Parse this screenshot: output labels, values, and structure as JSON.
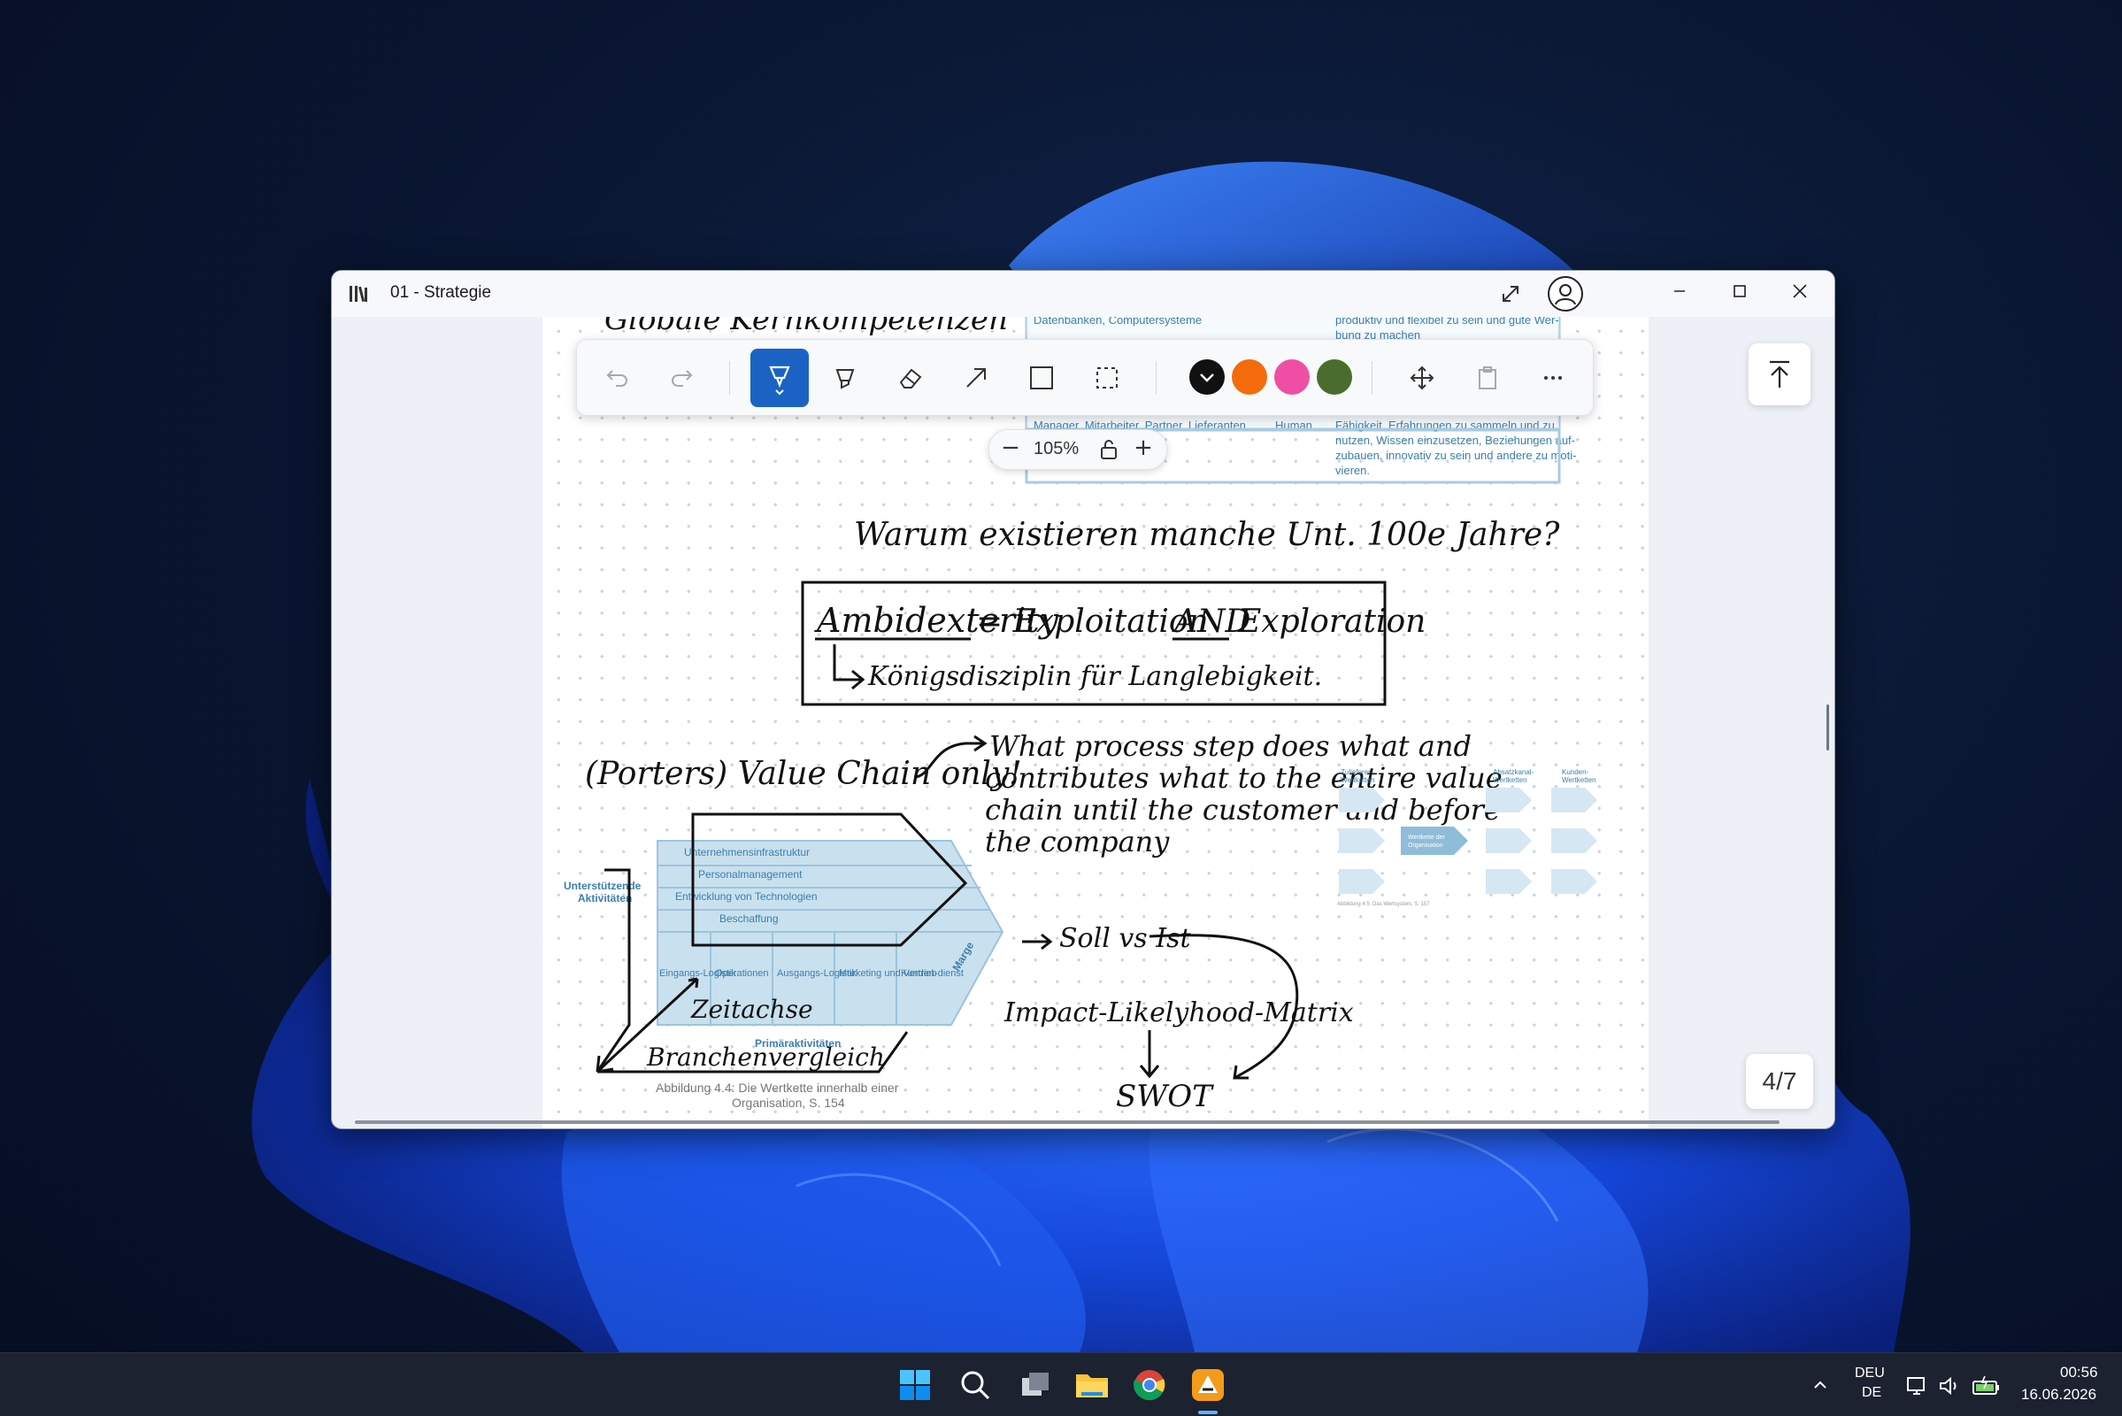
{
  "window": {
    "title": "01 - Strategie"
  },
  "toolbar": {
    "tools": [
      "undo-icon",
      "redo-icon",
      "pen-icon",
      "highlighter-icon",
      "eraser-icon",
      "arrow-icon",
      "rectangle-icon",
      "lasso-select-icon",
      "move-icon",
      "paste-icon",
      "more-icon"
    ],
    "active_tool": "pen-icon",
    "colors": [
      "#111111",
      "#f36b0b",
      "#ee4fa4",
      "#4a6d2e"
    ]
  },
  "zoom": {
    "minus": "−",
    "value": "105%",
    "plus": "+"
  },
  "page_counter": "4/7",
  "doc": {
    "top_table": {
      "row1_left": "Datenbanken, Computersysteme",
      "row1_right": "produktiv und flexibel zu sein und gute Wer-",
      "row1_right2": "bung zu machen",
      "row2_left": "Manager, Mitarbeiter, Partner, Lieferanten,",
      "row2_mid": "Human",
      "row2_right": [
        "Fähigkeit, Erfahrungen zu sammeln und zu",
        "nutzen, Wissen einzusetzen, Beziehungen auf-",
        "zubauen, innovativ zu sein und andere zu moti-",
        "vieren."
      ]
    },
    "handwriting": {
      "top_cut": "Globale Kernkompetenzen",
      "question": "Warum existieren manche Unt. 100e Jahre?",
      "box_line1_a": "Ambidexterity",
      "box_line1_b": "= Exploitation",
      "box_line1_c": "AND",
      "box_line1_d": "Exploration",
      "box_line2": "Königsdisziplin für Langlebigkeit.",
      "porter": "(Porters) Value Chain only!",
      "note": [
        "What process step does what and",
        "contributes what to the entire value",
        "chain until the customer and before",
        "the company"
      ],
      "soll": "Soll vs Ist",
      "impact": "Impact-Likelyhood-Matrix",
      "swot": "SWOT",
      "zeitachse": "Zeitachse",
      "branchen": "Branchenvergleich"
    },
    "value_chain": {
      "side_label": [
        "Unterstützende",
        "Aktivitäten"
      ],
      "support": [
        "Unternehmensinfrastruktur",
        "Personalmanagement",
        "Entwicklung von Technologien",
        "Beschaffung"
      ],
      "primary": [
        "Eingangs-Logistik",
        "Operationen",
        "Ausgangs-Logistik",
        "Marketing und Vertrieb",
        "Kunden-dienst"
      ],
      "primary_label": "Primäraktivitäten",
      "margin": "Marge",
      "caption": [
        "Abbildung 4.4: Die Wertkette innerhalb einer",
        "Organisation, S. 154"
      ]
    },
    "system": {
      "left_label": [
        "Zulieferer-",
        "Wertketten"
      ],
      "mid_label1": [
        "Absatzkanal-",
        "Wertketten"
      ],
      "mid_label2": [
        "Kunden-",
        "Wertketten"
      ],
      "center": [
        "Wertkette der",
        "Organisation"
      ],
      "caption": "Abbildung 4.5: Das Wertsystem, S. 157"
    }
  },
  "taskbar": {
    "apps": [
      "windows-start-icon",
      "search-icon",
      "task-view-icon",
      "file-explorer-icon",
      "chrome-icon",
      "notes-app-icon"
    ],
    "lang_top": "DEU",
    "lang_bottom": "DE",
    "time": "00:56",
    "date": "16.06.2026"
  }
}
